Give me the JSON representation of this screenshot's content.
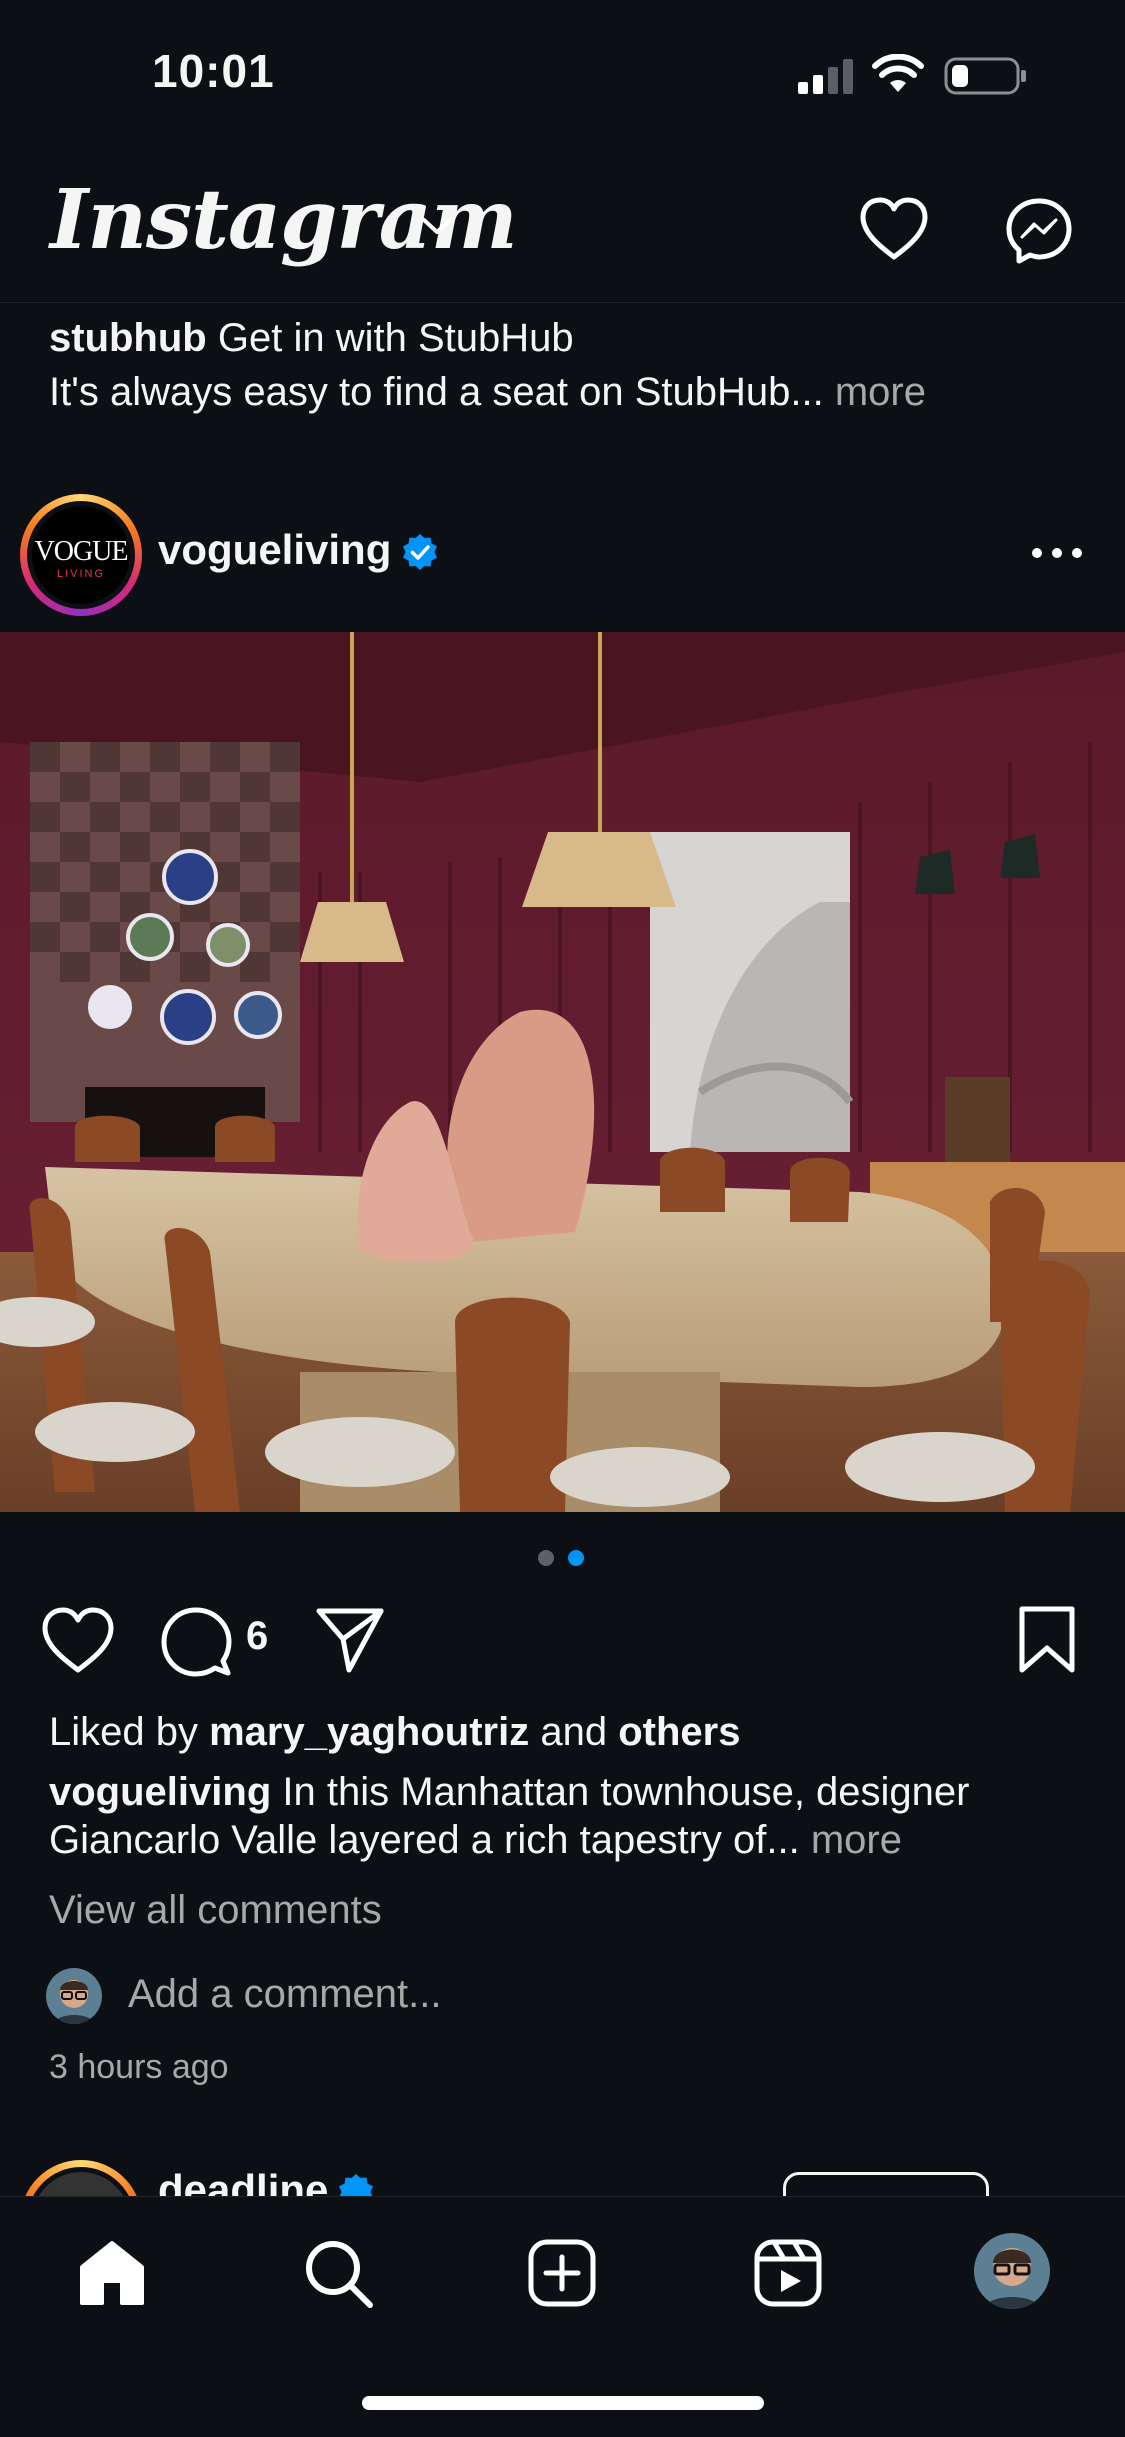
{
  "status_bar": {
    "time": "10:01"
  },
  "header": {
    "logo_text": "Instagram"
  },
  "ad": {
    "username": "stubhub",
    "headline": "Get in with StubHub",
    "body": "It's always easy to find a seat on StubHub...",
    "more": "more"
  },
  "post": {
    "avatar_text_line1": "VOGUE",
    "avatar_text_line2": "LIVING",
    "username": "vogueliving",
    "verified": true,
    "carousel": {
      "count": 2,
      "active": 2
    },
    "comment_count": "6",
    "liked_by_prefix": "Liked by",
    "liked_by_user": "mary_yaghoutriz",
    "liked_by_and": "and",
    "liked_by_others": "others",
    "caption_username": "vogueliving",
    "caption_text_1": "In this Manhattan townhouse, designer",
    "caption_text_2": "Giancarlo Valle layered a rich tapestry of...",
    "caption_more": "more",
    "view_all_comments": "View all comments",
    "add_comment_placeholder": "Add a comment...",
    "time_ago": "3 hours ago"
  },
  "next_post": {
    "username": "deadline",
    "verified": true
  },
  "colors": {
    "background": "#0c1014",
    "text": "#f5f5f5",
    "muted": "#a8a8a8",
    "verified_blue": "#0095f6",
    "story_ring": "#d62976"
  },
  "icons": {
    "header": [
      "chevron-down-icon",
      "heart-icon",
      "messenger-icon"
    ],
    "post": [
      "more-horizontal-icon",
      "heart-icon",
      "comment-icon",
      "share-icon",
      "bookmark-icon"
    ],
    "tabbar": [
      "home-icon",
      "search-icon",
      "create-icon",
      "reels-icon",
      "profile-avatar"
    ]
  }
}
